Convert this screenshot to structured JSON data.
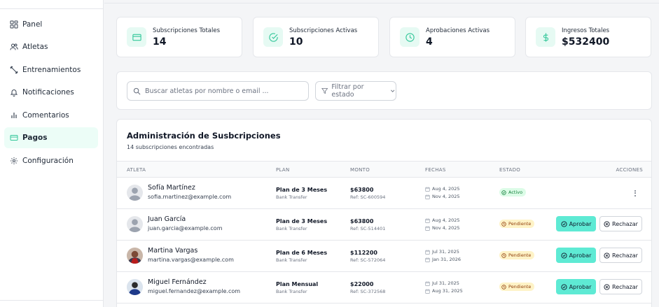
{
  "sidebar": {
    "items": [
      {
        "label": "Panel",
        "icon": "grid-icon"
      },
      {
        "label": "Atletas",
        "icon": "users-icon"
      },
      {
        "label": "Entrenamientos",
        "icon": "dumbbell-icon"
      },
      {
        "label": "Notificaciones",
        "icon": "bell-icon"
      },
      {
        "label": "Comentarios",
        "icon": "bar-chart-icon"
      },
      {
        "label": "Pagos",
        "icon": "credit-card-icon",
        "active": true
      },
      {
        "label": "Configuración",
        "icon": "gear-icon"
      }
    ]
  },
  "stats": [
    {
      "label": "Subscripciones Totales",
      "value": "14",
      "icon": "credit-card-icon"
    },
    {
      "label": "Subscripciones Activas",
      "value": "10",
      "icon": "check-circle-icon"
    },
    {
      "label": "Aprobaciones Activas",
      "value": "4",
      "icon": "clock-icon"
    },
    {
      "label": "Ingresos Totales",
      "value": "$532400",
      "icon": "dollar-icon"
    }
  ],
  "filters": {
    "search_placeholder": "Buscar atletas por nombre o email ...",
    "status_filter_label": "Filtrar por estado"
  },
  "table": {
    "title": "Administración de Susbcripciones",
    "subtitle": "14 subscripciones encontradas",
    "columns": [
      "ATLETA",
      "PLAN",
      "MONTO",
      "FECHAS",
      "ESTADO",
      "ACCIONES"
    ],
    "rows": [
      {
        "name": "Sofía Martínez",
        "email": "sofia.martinez@example.com",
        "plan": "Plan de 3 Meses",
        "method": "Bank Transfer",
        "amount": "$63800",
        "ref": "Ref: SC-600594",
        "start": "Aug 4, 2025",
        "end": "Nov 4, 2025",
        "status": "Activo",
        "avatar": "placeholder"
      },
      {
        "name": "Juan García",
        "email": "juan.garcia@example.com",
        "plan": "Plan de 3 Meses",
        "method": "Bank Transfer",
        "amount": "$63800",
        "ref": "Ref: SC-514401",
        "start": "Aug 4, 2025",
        "end": "Nov 4, 2025",
        "status": "Pendiente",
        "avatar": "placeholder"
      },
      {
        "name": "Martina Vargas",
        "email": "martina.vargas@example.com",
        "plan": "Plan de 6 Meses",
        "method": "Bank Transfer",
        "amount": "$112200",
        "ref": "Ref: SC-572064",
        "start": "Jul 31, 2025",
        "end": "Jan 31, 2026",
        "status": "Pendiente",
        "avatar": "photo"
      },
      {
        "name": "Miguel Fernández",
        "email": "miguel.fernandez@example.com",
        "plan": "Plan Mensual",
        "method": "Bank Transfer",
        "amount": "$22000",
        "ref": "Ref: SC-372568",
        "start": "Jul 31, 2025",
        "end": "Aug 31, 2025",
        "status": "Pendiente",
        "avatar": "photo"
      }
    ],
    "approve_label": "Aprobar",
    "reject_label": "Rechazar"
  },
  "colors": {
    "accent": "#34c79a",
    "accent_bg": "#e6faf3",
    "approve_button": "#5eead4",
    "active_badge_bg": "#dcfce7",
    "pending_badge_bg": "#fef3c7"
  }
}
